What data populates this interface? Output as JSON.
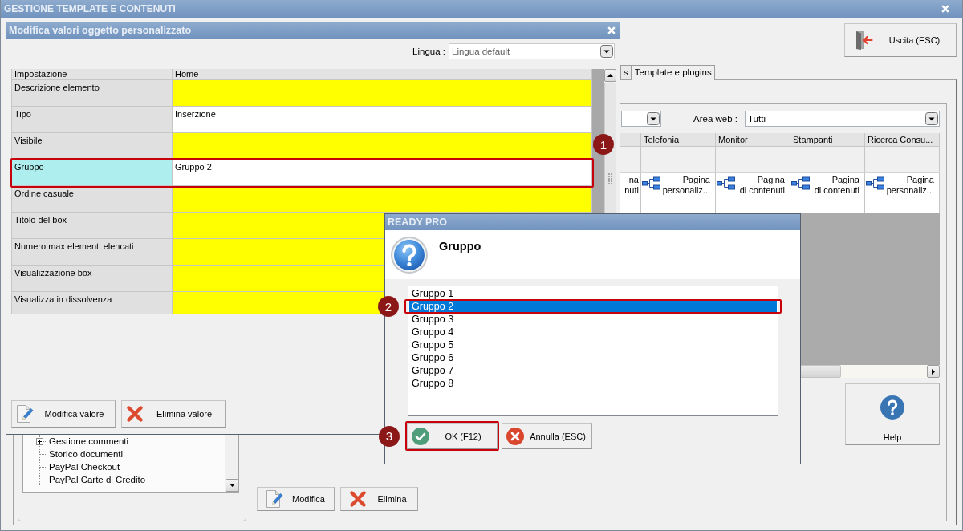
{
  "main_window": {
    "title": "GESTIONE TEMPLATE E CONTENUTI",
    "exit_button": "Uscita (ESC)",
    "tabs": [
      {
        "label": "s",
        "selected": false
      },
      {
        "label": "Template e plugins",
        "selected": true
      }
    ],
    "tree": {
      "items": [
        {
          "label": "Gestione commenti",
          "expandable": true
        },
        {
          "label": "Storico documenti",
          "expandable": false
        },
        {
          "label": "PayPal Checkout",
          "expandable": false
        },
        {
          "label": "PayPal Carte di Credito",
          "expandable": false
        }
      ]
    },
    "filter": {
      "area_web_label": "Area web :",
      "area_web_value": "Tutti"
    },
    "pages_grid": {
      "column_1": {
        "cell": "ina\nnuti"
      },
      "columns": [
        {
          "header": "Telefonia",
          "cell": "Pagina\npersonaliz..."
        },
        {
          "header": "Monitor",
          "cell": "Pagina\ndi contenuti"
        },
        {
          "header": "Stampanti",
          "cell": "Pagina\ndi contenuti"
        },
        {
          "header": "Ricerca Consu...",
          "cell": "Pagina\npersonaliz..."
        }
      ]
    },
    "help_button": "Help",
    "buttons": [
      {
        "label": "Modifica",
        "kind": "edit"
      },
      {
        "label": "Elimina",
        "kind": "delete"
      }
    ]
  },
  "edit_dialog": {
    "title": "Modifica valori oggetto personalizzato",
    "language_label": "Lingua :",
    "language": {
      "value": "Lingua default",
      "disabled": true
    },
    "columns": [
      "Impostazione",
      "Home"
    ],
    "rows": [
      {
        "label": "Descrizione elemento",
        "selected": false
      },
      {
        "label": "Tipo",
        "value": "Inserzione",
        "selected": false
      },
      {
        "label": "Visibile",
        "selected": false
      },
      {
        "label": "Gruppo",
        "value": "Gruppo 2",
        "selected": true,
        "callout": "1"
      },
      {
        "label": "Ordine casuale",
        "selected": false
      },
      {
        "label": "Titolo del box",
        "selected": false
      },
      {
        "label": "Numero max elementi elencati",
        "selected": false
      },
      {
        "label": "Visualizzazione box",
        "selected": false
      },
      {
        "label": "Visualizza in dissolvenza",
        "selected": false
      }
    ],
    "buttons": [
      {
        "label": "Modifica valore",
        "kind": "edit"
      },
      {
        "label": "Elimina valore",
        "kind": "delete"
      }
    ]
  },
  "choice_dialog": {
    "title": "READY PRO",
    "prompt": "Gruppo",
    "options": [
      {
        "label": "Gruppo 1",
        "selected": false
      },
      {
        "label": "Gruppo 2",
        "selected": true,
        "callout": "2"
      },
      {
        "label": "Gruppo 3",
        "selected": false
      },
      {
        "label": "Gruppo 4",
        "selected": false
      },
      {
        "label": "Gruppo 5",
        "selected": false
      },
      {
        "label": "Gruppo 6",
        "selected": false
      },
      {
        "label": "Gruppo 7",
        "selected": false
      },
      {
        "label": "Gruppo 8",
        "selected": false
      }
    ],
    "buttons": [
      {
        "label": "OK (F12)",
        "kind": "confirm",
        "callout": "3"
      },
      {
        "label": "Annulla (ESC)",
        "kind": "cancel"
      }
    ]
  }
}
